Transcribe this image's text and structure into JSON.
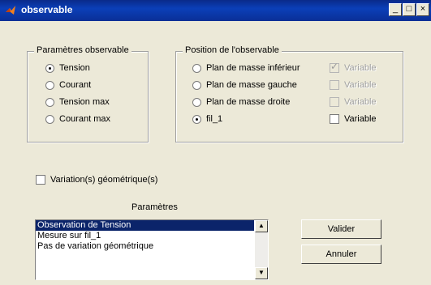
{
  "window": {
    "title": "observable",
    "minimize_glyph": "_",
    "maximize_glyph": "□",
    "close_glyph": "×"
  },
  "params_group": {
    "legend": "Paramètres observable",
    "options": [
      {
        "label": "Tension",
        "selected": true
      },
      {
        "label": "Courant",
        "selected": false
      },
      {
        "label": "Tension max",
        "selected": false
      },
      {
        "label": "Courant max",
        "selected": false
      }
    ]
  },
  "position_group": {
    "legend": "Position de l'observable",
    "options": [
      {
        "label": "Plan de masse inférieur",
        "selected": false,
        "variable_label": "Variable",
        "variable_checked": true,
        "variable_enabled": false
      },
      {
        "label": "Plan de masse gauche",
        "selected": false,
        "variable_label": "Variable",
        "variable_checked": false,
        "variable_enabled": false
      },
      {
        "label": "Plan de masse droite",
        "selected": false,
        "variable_label": "Variable",
        "variable_checked": false,
        "variable_enabled": false
      },
      {
        "label": "fil_1",
        "selected": true,
        "variable_label": "Variable",
        "variable_checked": false,
        "variable_enabled": true
      }
    ]
  },
  "variation_checkbox": {
    "label": "Variation(s) géométrique(s)",
    "checked": false
  },
  "parametres_label": "Paramètres",
  "list": {
    "items": [
      "Observation de Tension",
      "Mesure sur fil_1",
      "Pas de variation géométrique"
    ],
    "selected_index": 0
  },
  "buttons": {
    "validate": "Valider",
    "cancel": "Annuler"
  }
}
